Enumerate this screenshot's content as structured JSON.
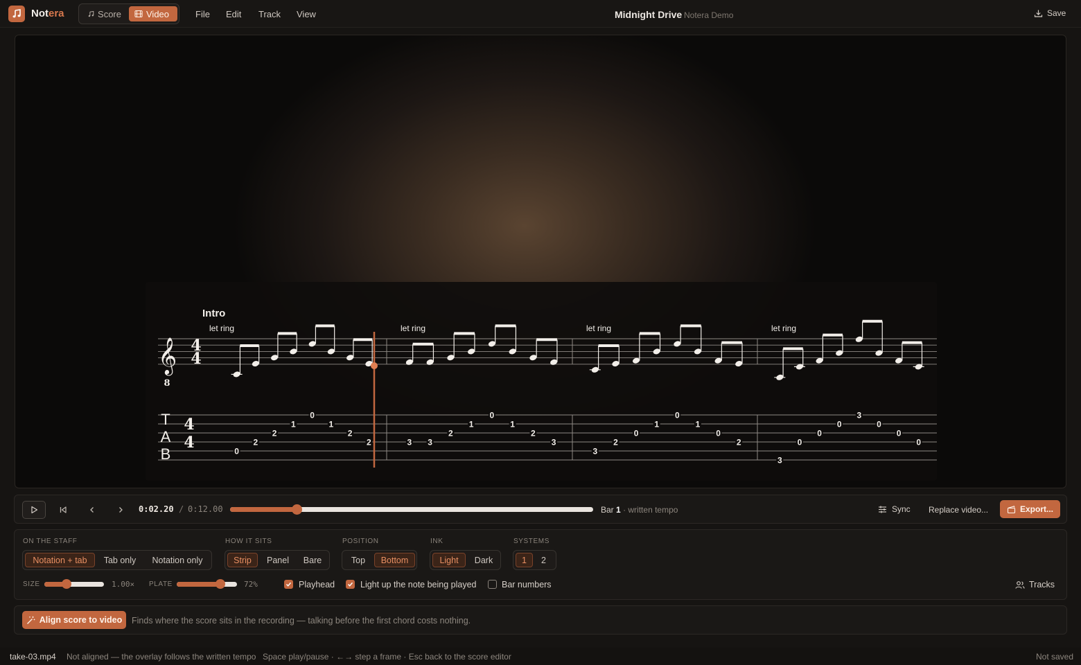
{
  "app": {
    "name_main": "Not",
    "name_accent": "era",
    "modes": [
      {
        "label": "Score",
        "active": false
      },
      {
        "label": "Video",
        "active": true
      }
    ],
    "menu": [
      "File",
      "Edit",
      "Track",
      "View"
    ],
    "doc_title": "Midnight Drive",
    "doc_subtitle": "Notera Demo",
    "save_label": "Save"
  },
  "score": {
    "section": "Intro",
    "annotation": "let ring",
    "time_signature": "4/4",
    "clef": "treble-8vb",
    "tab_clef": [
      "T",
      "A",
      "B"
    ],
    "bars": [
      {
        "notes": [
          {
            "string": 5,
            "fret": "0"
          },
          {
            "string": 4,
            "fret": "2"
          },
          {
            "string": 3,
            "fret": "2"
          },
          {
            "string": 2,
            "fret": "1"
          },
          {
            "string": 1,
            "fret": "0"
          },
          {
            "string": 2,
            "fret": "1"
          },
          {
            "string": 3,
            "fret": "2"
          },
          {
            "string": 4,
            "fret": "2"
          }
        ]
      },
      {
        "notes": [
          {
            "string": 4,
            "fret": "3"
          },
          {
            "string": 4,
            "fret": "3"
          },
          {
            "string": 3,
            "fret": "2"
          },
          {
            "string": 2,
            "fret": "1"
          },
          {
            "string": 1,
            "fret": "0"
          },
          {
            "string": 2,
            "fret": "1"
          },
          {
            "string": 3,
            "fret": "2"
          },
          {
            "string": 4,
            "fret": "3"
          }
        ]
      },
      {
        "notes": [
          {
            "string": 5,
            "fret": "3"
          },
          {
            "string": 4,
            "fret": "2"
          },
          {
            "string": 3,
            "fret": "0"
          },
          {
            "string": 2,
            "fret": "1"
          },
          {
            "string": 1,
            "fret": "0"
          },
          {
            "string": 2,
            "fret": "1"
          },
          {
            "string": 3,
            "fret": "0"
          },
          {
            "string": 4,
            "fret": "2"
          }
        ]
      },
      {
        "notes": [
          {
            "string": 6,
            "fret": "3"
          },
          {
            "string": 4,
            "fret": "0"
          },
          {
            "string": 3,
            "fret": "0"
          },
          {
            "string": 2,
            "fret": "0"
          },
          {
            "string": 1,
            "fret": "3"
          },
          {
            "string": 2,
            "fret": "0"
          },
          {
            "string": 3,
            "fret": "0"
          },
          {
            "string": 4,
            "fret": "0"
          }
        ]
      }
    ]
  },
  "transport": {
    "current_time": "0:02.20",
    "separator": "/",
    "total_time": "0:12.00",
    "progress": 0.1833,
    "bar_prefix": "Bar",
    "bar_number": "1",
    "bar_suffix": "· written tempo",
    "sync_label": "Sync",
    "replace_label": "Replace video...",
    "export_label": "Export..."
  },
  "options": {
    "on_staff": {
      "label": "ON THE STAFF",
      "items": [
        "Notation + tab",
        "Tab only",
        "Notation only"
      ],
      "selected": 0
    },
    "how_it_sits": {
      "label": "HOW IT SITS",
      "items": [
        "Strip",
        "Panel",
        "Bare"
      ],
      "selected": 0
    },
    "position": {
      "label": "POSITION",
      "items": [
        "Top",
        "Bottom"
      ],
      "selected": 1
    },
    "ink": {
      "label": "INK",
      "items": [
        "Light",
        "Dark"
      ],
      "selected": 0
    },
    "systems": {
      "label": "SYSTEMS",
      "items": [
        "1",
        "2"
      ],
      "selected": 0
    },
    "size": {
      "label": "SIZE",
      "value_text": "1.00×",
      "fraction": 0.37
    },
    "plate": {
      "label": "PLATE",
      "value_text": "72%",
      "fraction": 0.72
    },
    "playhead": {
      "label": "Playhead",
      "checked": true
    },
    "light_up": {
      "label": "Light up the note being played",
      "checked": true
    },
    "bar_numbers": {
      "label": "Bar numbers",
      "checked": false
    },
    "tracks_label": "Tracks"
  },
  "align": {
    "button_label": "Align score to video",
    "hint": "Finds where the score sits in the recording — talking before the first chord costs nothing."
  },
  "status": {
    "file": "take-03.mp4",
    "alignment": "Not aligned — the overlay follows the written tempo",
    "shortcuts": "Space play/pause · ←→ step a frame · Esc back to the score editor",
    "saved": "Not saved"
  },
  "colors": {
    "accent": "#c2673f",
    "background": "#161412",
    "panel": "#1a1816"
  }
}
